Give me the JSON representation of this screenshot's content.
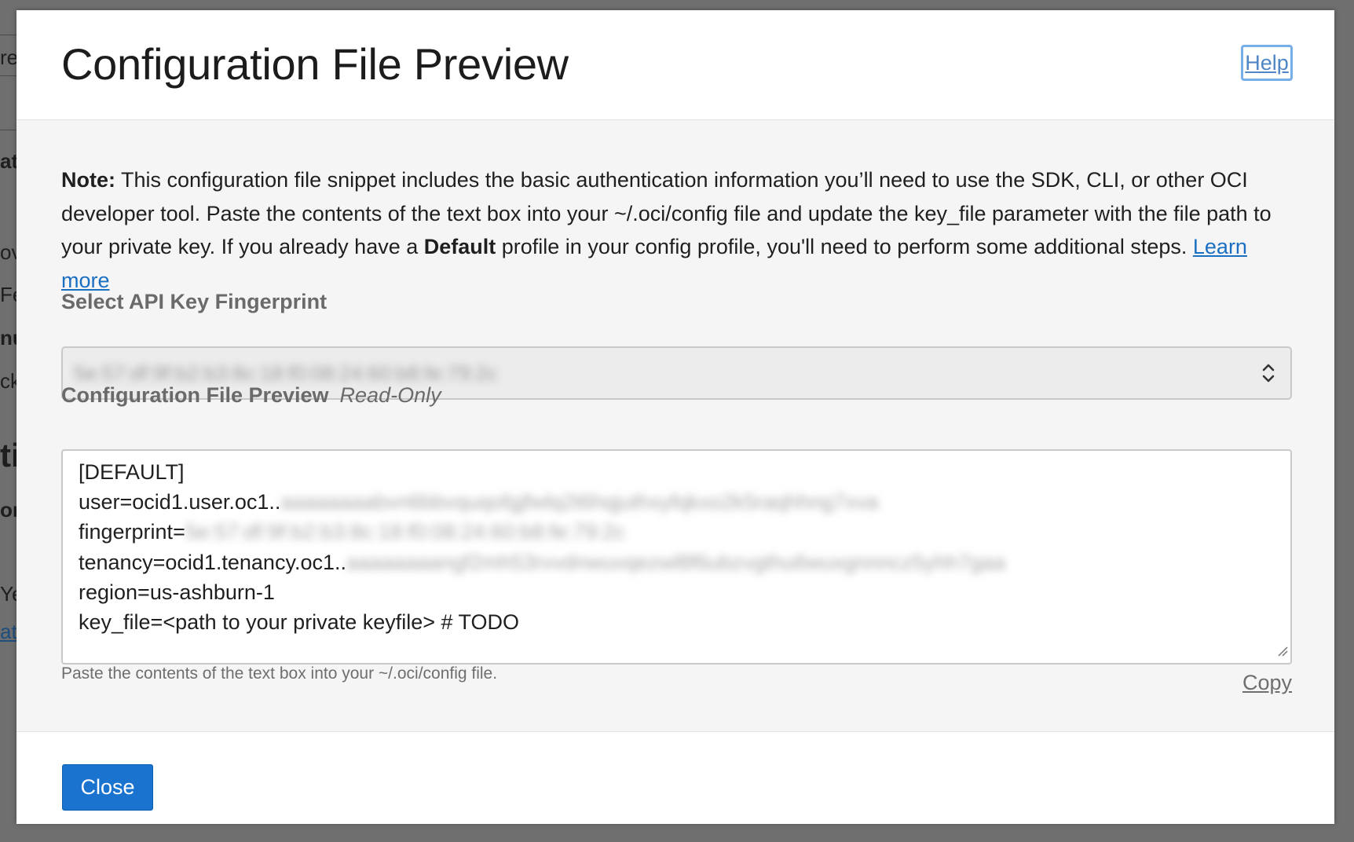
{
  "background": {
    "fragments": [
      "re",
      "at",
      "ov",
      "Fe",
      "nu",
      "ck",
      "ti",
      "or",
      "Ye",
      "at"
    ]
  },
  "dialog": {
    "title": "Configuration File Preview",
    "help_label": "Help",
    "note": {
      "bold_prefix": "Note:",
      "text_1": " This configuration file snippet includes the basic authentication information you’ll need to use the SDK, CLI, or other OCI developer tool. Paste the contents of the text box into your ~/.oci/config file and update the key_file parameter with the file path to your private key. If you already have a ",
      "bold_default": "Default",
      "text_2": " profile in your config profile, you'll need to perform some additional steps. ",
      "learn_more": "Learn more"
    },
    "fingerprint_select": {
      "label": "Select API Key Fingerprint",
      "value": "5e:57:df:9f:b2:b3:8c:18:f0:08:24:60:b8:fe:79:2c"
    },
    "preview": {
      "label": "Configuration File Preview",
      "readonly_label": "Read-Only",
      "lines": {
        "header": "[DEFAULT]",
        "user_key": "user=ocid1.user.oc1..",
        "user_redacted": "aaaaaaaabvn6bbvquqofgjfwlq2t6hqjuthxyfqkxo2k5raqhhng7xva",
        "fingerprint_key": "fingerprint=",
        "fingerprint_redacted": "5e:57:df:9f:b2:b3:8c:18:f0:08:24:60:b8:fe:79:2c",
        "tenancy_key": "tenancy=ocid1.tenancy.oc1..",
        "tenancy_redacted": "aaaaaaaangf2mh53rvvdnwuvqezwl8f6ubzvgthu6wuxgnnncz5yhh7gaa",
        "region": "region=us-ashburn-1",
        "key_file": "key_file=<path to your private keyfile> # TODO"
      }
    },
    "hint": "Paste the contents of the text box into your ~/.oci/config file.",
    "copy_label": "Copy",
    "close_label": "Close"
  },
  "icons": {
    "select": "up-down-chevron-icon",
    "resize": "resize-grip-icon"
  },
  "colors": {
    "primary_button": "#1a73cf",
    "link": "#1b6fc2",
    "help_focus_ring": "#78aee8"
  }
}
